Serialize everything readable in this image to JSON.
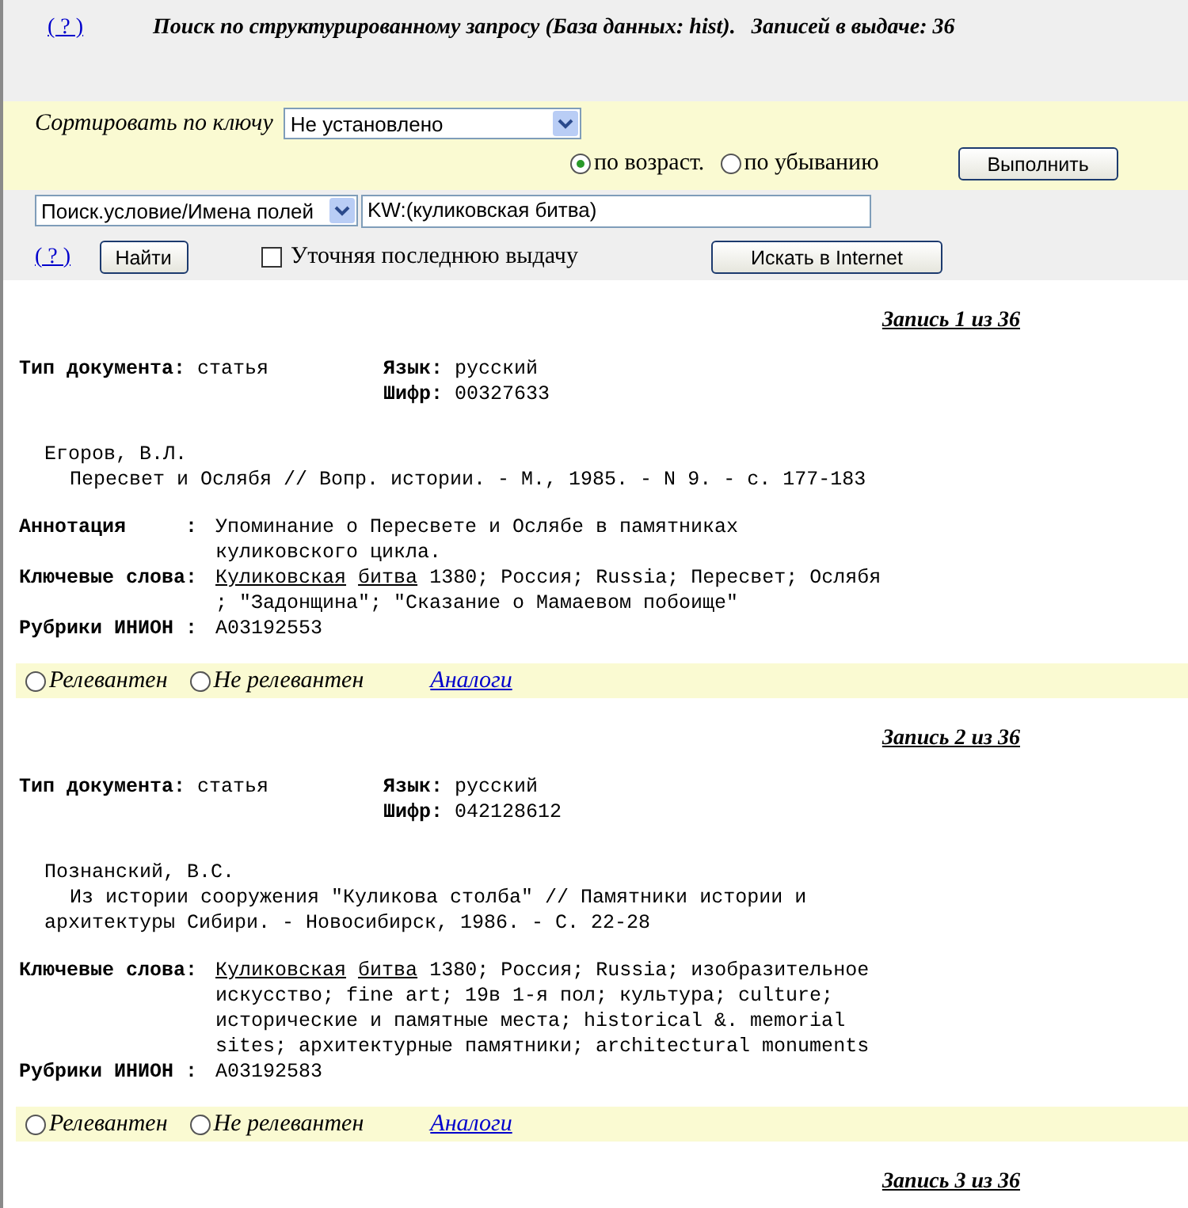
{
  "header": {
    "help_link": "( ? )",
    "title": "Поиск по структурированному запросу (База данных: hist).",
    "count": "Записей в выдаче: 36"
  },
  "sort": {
    "label": "Сортировать по ключу",
    "value": "Не установлено",
    "orders": [
      {
        "label": "по возраст.",
        "selected": true
      },
      {
        "label": "по убыванию",
        "selected": false
      }
    ],
    "run_button": "Выполнить"
  },
  "search": {
    "field_select": "Поиск.условие/Имена полей",
    "query": "KW:(куликовская битва)",
    "help_link": "( ? )",
    "find_button": "Найти",
    "refine": {
      "label": "Уточняя последнюю выдачу",
      "checked": false
    },
    "internet_button": "Искать в Internet"
  },
  "records": [
    {
      "heading": "Запись 1 из 36",
      "doc_type_label": "Тип документа:",
      "doc_type": "статья",
      "lang_label": "Язык:",
      "lang": "русский",
      "code_label": "Шифр:",
      "code": "00327633",
      "author": "Егоров, В.Л.",
      "citation": [
        "Пересвет и Ослябя // Вопр. истории. - М., 1985. - N 9. - с. 177-183"
      ],
      "fields": [
        {
          "label": "Аннотация     :",
          "lines": [
            "Упоминание о Пересвете и Ослябе в памятниках",
            "куликовского цикла."
          ]
        },
        {
          "label": "Ключевые слова:",
          "links": [
            "Куликовская",
            "битва"
          ],
          "lines": [
            "1380; Россия; Russia; Пересвет; Ослябя",
            "; \"Задонщина\"; \"Сказание о Мамаевом побоище\""
          ]
        },
        {
          "label": "Рубрики ИНИОН :",
          "lines": [
            "A03192553"
          ]
        }
      ],
      "relevance": [
        {
          "label": "Релевантен",
          "selected": false
        },
        {
          "label": "Не релевантен",
          "selected": false
        }
      ],
      "analogs_link": "Аналоги"
    },
    {
      "heading": "Запись 2 из 36",
      "doc_type_label": "Тип документа:",
      "doc_type": "статья",
      "lang_label": "Язык:",
      "lang": "русский",
      "code_label": "Шифр:",
      "code": "042128612",
      "author": "Познанский, В.С.",
      "citation": [
        "Из истории сооружения \"Куликова столба\" // Памятники истории и",
        "архитектуры Сибири. - Новосибирск, 1986. - С. 22-28"
      ],
      "fields": [
        {
          "label": "Ключевые слова:",
          "links": [
            "Куликовская",
            "битва"
          ],
          "lines": [
            "1380; Россия; Russia; изобразительное",
            "искусство; fine art; 19в 1-я пол; культура; culture;",
            "исторические и памятные места; historical &. memorial",
            "sites; архитектурные памятники; architectural monuments"
          ]
        },
        {
          "label": "Рубрики ИНИОН :",
          "lines": [
            "A03192583"
          ]
        }
      ],
      "relevance": [
        {
          "label": "Релевантен",
          "selected": false
        },
        {
          "label": "Не релевантен",
          "selected": false
        }
      ],
      "analogs_link": "Аналоги"
    },
    {
      "heading": "Запись 3 из 36"
    }
  ]
}
